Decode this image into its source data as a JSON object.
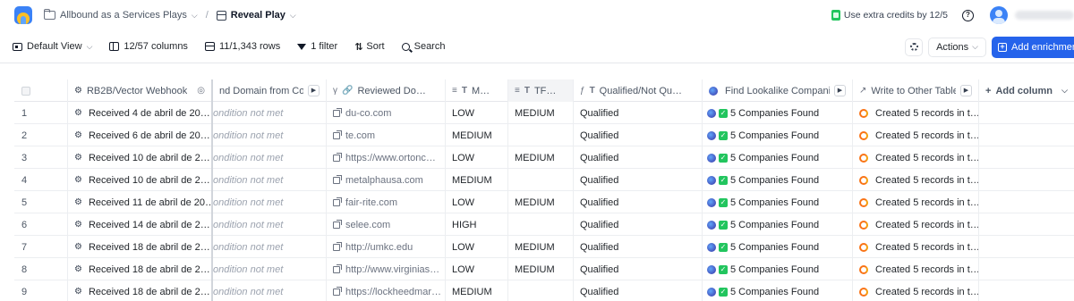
{
  "header": {
    "breadcrumb_workbook": "Allbound as a Services Plays",
    "breadcrumb_table": "Reveal Play",
    "credits_text": "Use extra credits by 12/5",
    "help_label": "?"
  },
  "toolbar": {
    "view_label": "Default View",
    "columns_label": "12/57 columns",
    "rows_label": "11/1,343 rows",
    "filter_label": "1 filter",
    "sort_label": "Sort",
    "search_label": "Search",
    "actions_label": "Actions",
    "enrich_label": "Add enrichment"
  },
  "grid": {
    "columns": [
      "RB2B/Vector Webhook",
      "nd Domain from Com…",
      "Reviewed Do…",
      "M…",
      "TF…",
      "Qualified/Not Qu…",
      "Find Lookalike Companie…",
      "Write to Other Table"
    ],
    "add_column_label": "Add column",
    "rows": [
      {
        "num": "1",
        "webhook": "Received 4 de abril de 20…",
        "domain_from": "ondition not met",
        "reviewed": "du-co.com",
        "m": "LOW",
        "tf": "MEDIUM",
        "qualified": "Qualified",
        "lookalike": "5 Companies Found",
        "write": "Created 5 records in t…"
      },
      {
        "num": "2",
        "webhook": "Received 6 de abril de 20…",
        "domain_from": "ondition not met",
        "reviewed": "te.com",
        "m": "MEDIUM",
        "tf": "",
        "qualified": "Qualified",
        "lookalike": "5 Companies Found",
        "write": "Created 5 records in t…"
      },
      {
        "num": "3",
        "webhook": "Received 10 de abril de 2…",
        "domain_from": "ondition not met",
        "reviewed": "https://www.ortonc…",
        "m": "LOW",
        "tf": "MEDIUM",
        "qualified": "Qualified",
        "lookalike": "5 Companies Found",
        "write": "Created 5 records in t…"
      },
      {
        "num": "4",
        "webhook": "Received 10 de abril de 2…",
        "domain_from": "ondition not met",
        "reviewed": "metalphausa.com",
        "m": "MEDIUM",
        "tf": "",
        "qualified": "Qualified",
        "lookalike": "5 Companies Found",
        "write": "Created 5 records in t…"
      },
      {
        "num": "5",
        "webhook": "Received 11 de abril de 20…",
        "domain_from": "ondition not met",
        "reviewed": "fair-rite.com",
        "m": "LOW",
        "tf": "MEDIUM",
        "qualified": "Qualified",
        "lookalike": "5 Companies Found",
        "write": "Created 5 records in t…"
      },
      {
        "num": "6",
        "webhook": "Received 14 de abril de 2…",
        "domain_from": "ondition not met",
        "reviewed": "selee.com",
        "m": "HIGH",
        "tf": "",
        "qualified": "Qualified",
        "lookalike": "5 Companies Found",
        "write": "Created 5 records in t…"
      },
      {
        "num": "7",
        "webhook": "Received 18 de abril de 2…",
        "domain_from": "ondition not met",
        "reviewed": "http://umkc.edu",
        "m": "LOW",
        "tf": "MEDIUM",
        "qualified": "Qualified",
        "lookalike": "5 Companies Found",
        "write": "Created 5 records in t…"
      },
      {
        "num": "8",
        "webhook": "Received 18 de abril de 2…",
        "domain_from": "ondition not met",
        "reviewed": "http://www.virginias…",
        "m": "LOW",
        "tf": "MEDIUM",
        "qualified": "Qualified",
        "lookalike": "5 Companies Found",
        "write": "Created 5 records in t…"
      },
      {
        "num": "9",
        "webhook": "Received 18 de abril de 2…",
        "domain_from": "ondition not met",
        "reviewed": "https://lockheedmar…",
        "m": "MEDIUM",
        "tf": "",
        "qualified": "Qualified",
        "lookalike": "5 Companies Found",
        "write": "Created 5 records in t…"
      }
    ]
  }
}
